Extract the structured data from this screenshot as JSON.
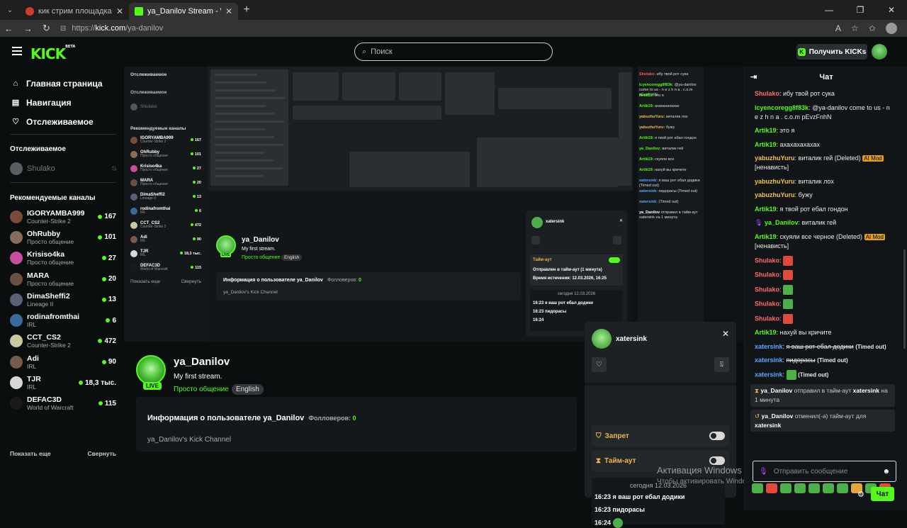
{
  "browser": {
    "tabs": [
      {
        "title": "кик стрим площадка — Яндекс",
        "active": false
      },
      {
        "title": "ya_Danilov Stream - Watch Live on",
        "active": true
      }
    ],
    "url_scheme": "https://",
    "url_host": "kick.com",
    "url_path": "/ya-danilov"
  },
  "header": {
    "logo": "KICK",
    "logo_beta": "BETA",
    "search_placeholder": "Поиск",
    "get_kicks": "Получить KICKs"
  },
  "sidebar": {
    "nav": [
      {
        "label": "Главная страница",
        "icon": "home-icon"
      },
      {
        "label": "Навигация",
        "icon": "browse-icon"
      },
      {
        "label": "Отслеживаемое",
        "icon": "heart-icon"
      }
    ],
    "following_title": "Отслеживаемое",
    "following": [
      {
        "name": "Shulako"
      }
    ],
    "recommended_title": "Рекомендуемые каналы",
    "recommended": [
      {
        "name": "IGORYAMBA999",
        "category": "Counter-Strike 2",
        "viewers": "167",
        "color": "#7a4a3a"
      },
      {
        "name": "OhRubby",
        "category": "Просто общение",
        "viewers": "101",
        "color": "#8a6a5a"
      },
      {
        "name": "Krisiso4ka",
        "category": "Просто общение",
        "viewers": "27",
        "color": "#c94da0"
      },
      {
        "name": "MARA",
        "category": "Просто общение",
        "viewers": "20",
        "color": "#6a5040"
      },
      {
        "name": "DimaSheffi2",
        "category": "Lineage II",
        "viewers": "13",
        "color": "#5a5f7a"
      },
      {
        "name": "rodinafromthai",
        "category": "IRL",
        "viewers": "6",
        "color": "#3a6a9a"
      },
      {
        "name": "CCT_CS2",
        "category": "Counter-Strike 2",
        "viewers": "472",
        "color": "#c9c9a0"
      },
      {
        "name": "Adi",
        "category": "IRL",
        "viewers": "90",
        "color": "#7a5a4a"
      },
      {
        "name": "TJR",
        "category": "IRL",
        "viewers": "18,3 тыс.",
        "color": "#d8d8d8"
      },
      {
        "name": "DEFAC3D",
        "category": "World of Warcraft",
        "viewers": "115",
        "color": "#1a1a1a"
      }
    ],
    "show_more": "Показать еще",
    "collapse": "Свернуть"
  },
  "channel": {
    "name": "ya_Danilov",
    "title": "My first stream.",
    "category": "Просто общение",
    "language": "English",
    "live": "LIVE",
    "about_title": "Информация о пользователе ya_Danilov",
    "followers_label": "Фолловеров:",
    "followers": "0",
    "about_desc": "ya_Danilov's Kick Channel"
  },
  "mini_stream": {
    "following_title": "Отслеживаемое",
    "following_name": "Shulako",
    "recommended_title": "Рекомендуемые каналы",
    "show_more": "Показать еще",
    "collapse": "Свернуть",
    "chat_lines": [
      {
        "user": "Shulako:",
        "text": "ибу твой рот сука",
        "color": "#ff5a5a"
      },
      {
        "user": "icyencoregg8f83k:",
        "text": "@ya-danilov come to us - n e z h n a . c.o.m pEvzFnhN",
        "color": "#53fc18"
      },
      {
        "user": "Artik19:",
        "text": "это я",
        "color": "#53fc18"
      },
      {
        "user": "Artik19:",
        "text": "ахахахахахах",
        "color": "#53fc18"
      },
      {
        "user": "yabuzhuYuru:",
        "text": "виталик лох",
        "color": "#f0c040"
      },
      {
        "user": "yabuzhuYuru:",
        "text": "бужу",
        "color": "#f0c040"
      },
      {
        "user": "Artik19:",
        "text": "я твой рот ебал гондон",
        "color": "#53fc18"
      },
      {
        "user": "ya_Danilov:",
        "text": "виталик гей",
        "color": "#53fc18"
      },
      {
        "user": "Artik19:",
        "text": "скуяли все",
        "color": "#53fc18"
      },
      {
        "user": "Artik19:",
        "text": "нахуй вы кричите",
        "color": "#53fc18"
      },
      {
        "user": "xatersink:",
        "text": "я ваш рот ебал додики (Timed out)",
        "color": "#5aa8ff"
      },
      {
        "user": "xatersink:",
        "text": "пидорасы (Timed out)",
        "color": "#5aa8ff"
      },
      {
        "user": "xatersink:",
        "text": "(Timed out)",
        "color": "#5aa8ff"
      },
      {
        "user": "ya_Danilov",
        "text": "отправил в тайм-аут xatersink на 1 минута",
        "color": "#fff"
      }
    ],
    "panel_name": "xatersink",
    "panel_timeout": "Тайм-аут",
    "panel_sent": "Отправлен в тайм-аут (1 минута)",
    "panel_expiry": "Время истечения: 12.03.2026, 16:25",
    "panel_date": "сегодня 12.03.2026",
    "panel_lines": [
      "16:23 я ваш рот ебал додики",
      "16:23 пидорасы",
      "16:24"
    ]
  },
  "usercard": {
    "name": "xatersink",
    "ban_label": "Запрет",
    "timeout_label": "Тайм-аут",
    "history_date": "сегодня 12.03.2026",
    "history": [
      {
        "time": "16:23",
        "text": "я ваш рот ебал додики"
      },
      {
        "time": "16:23",
        "text": "пидорасы"
      },
      {
        "time": "16:24",
        "text": ""
      }
    ]
  },
  "windows_activation": {
    "title": "Активация Windows",
    "subtitle": "Чтобы активировать Windows, перейдите в раздел \"Параметры\"."
  },
  "chat": {
    "title": "Чат",
    "input_placeholder": "Отправить сообщение",
    "send": "Чат",
    "messages": [
      {
        "user": "Shulako",
        "color": "#ff6b6b",
        "text": "ибу твой рот сука"
      },
      {
        "user": "icyencoregg8f83k",
        "color": "#53fc18",
        "text": "@ya-danilov come to us - n e z h n a . c.o.m pEvzFnhN"
      },
      {
        "user": "Artik19",
        "color": "#53fc18",
        "text": "это я"
      },
      {
        "user": "Artik19",
        "color": "#53fc18",
        "text": "ахахахахахах"
      },
      {
        "user": "yabuzhuYuru",
        "color": "#f5c542",
        "text": "виталик",
        "deleted_text": "гей",
        "deleted": "(Deleted)",
        "tag": "AI Mod",
        "reason": "[ненависть]"
      },
      {
        "user": "yabuzhuYuru",
        "color": "#f5c542",
        "text": "виталик лох"
      },
      {
        "user": "yabuzhuYuru",
        "color": "#f5c542",
        "text": "бужу"
      },
      {
        "user": "Artik19",
        "color": "#53fc18",
        "text": "я твой рот ебал гондон"
      },
      {
        "user": "ya_Danilov",
        "color": "#53fc18",
        "text": "виталик гей",
        "mic": true
      },
      {
        "user": "Artik19",
        "color": "#53fc18",
        "text": "скуяли все",
        "deleted_text": "черное",
        "deleted": "(Deleted)",
        "tag": "AI Mod",
        "reason": "[ненависть]"
      },
      {
        "user": "Shulako",
        "color": "#ff6b6b",
        "emote": "#e04a3a"
      },
      {
        "user": "Shulako",
        "color": "#ff6b6b",
        "emote": "#e04a3a"
      },
      {
        "user": "Shulako",
        "color": "#ff6b6b",
        "emote": "#4caf4a"
      },
      {
        "user": "Shulako",
        "color": "#ff6b6b",
        "emote": "#4caf4a"
      },
      {
        "user": "Shulako",
        "color": "#ff6b6b",
        "emote": "#e04a3a"
      },
      {
        "user": "Artik19",
        "color": "#53fc18",
        "text": "нахуй вы кричите"
      },
      {
        "user": "xatersink",
        "color": "#5aa8ff",
        "strike": "я ваш рот ебал додики",
        "note": "(Timed out)"
      },
      {
        "user": "xatersink",
        "color": "#5aa8ff",
        "strike": "пидорасы",
        "note": "(Timed out)"
      },
      {
        "user": "xatersink",
        "color": "#5aa8ff",
        "emote": "#4caf4a",
        "note": "(Timed out)"
      }
    ],
    "system": [
      {
        "icon": "hourglass-icon",
        "user": "ya_Danilov",
        "text": "отправил в тайм-аут",
        "target": "xatersink",
        "tail": "на 1 минута"
      },
      {
        "icon": "undo-icon",
        "user": "ya_Danilov",
        "text": "отменил(-а) тайм-аут для",
        "target": "xatersink",
        "tail": ""
      }
    ],
    "emotes": [
      "#4caf4a",
      "#e04a3a",
      "#4caf4a",
      "#4caf4a",
      "#4caf4a",
      "#4caf4a",
      "#4caf4a",
      "#e0a63a",
      "#4caf4a",
      "#e04a3a"
    ]
  }
}
